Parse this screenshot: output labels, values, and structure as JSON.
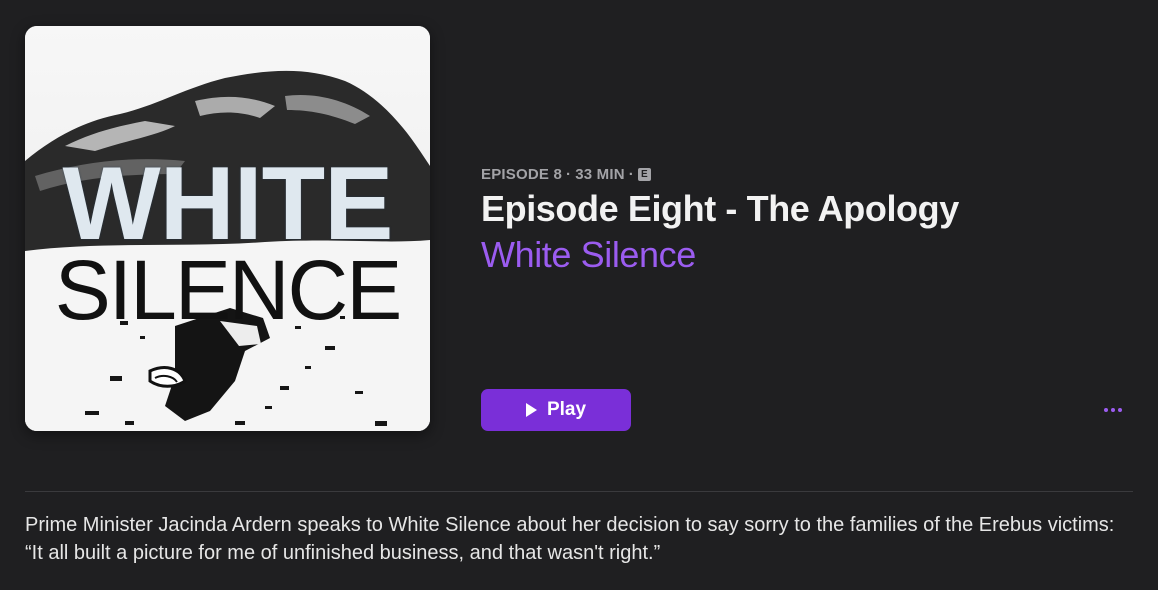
{
  "episode": {
    "meta": {
      "number_label": "EPISODE 8",
      "separator": "·",
      "duration": "33 MIN",
      "explicit_badge": "E"
    },
    "title": "Episode Eight - The Apology",
    "show_name": "White Silence",
    "description": "Prime Minister Jacinda Ardern speaks to White Silence about her decision to say sorry to the families of the Erebus victims: “It all built a picture for me of unfinished business, and that wasn't right.”"
  },
  "artwork": {
    "word_top": "WHITE",
    "word_bottom": "SILENCE"
  },
  "actions": {
    "play_label": "Play",
    "play_icon": "play-triangle-icon",
    "more_icon": "ellipsis-icon"
  },
  "colors": {
    "background": "#1f1f21",
    "accent": "#9b5cf0",
    "play_button": "#7a2fd8",
    "meta_text": "#a3a3a7"
  }
}
